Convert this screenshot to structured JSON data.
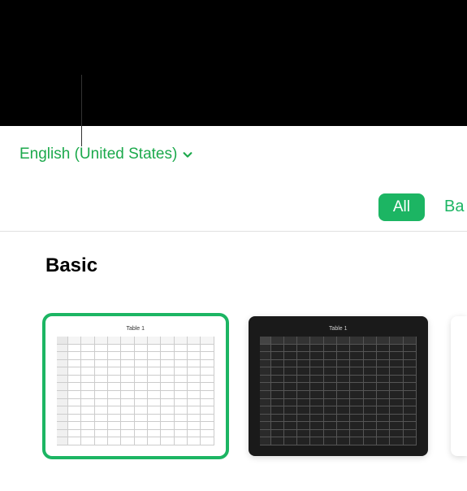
{
  "language": {
    "selected": "English (United States)"
  },
  "filters": {
    "all": "All",
    "basic_peek": "Ba"
  },
  "section": {
    "title": "Basic"
  },
  "templates": {
    "items": [
      {
        "title": "Table 1",
        "theme": "light",
        "selected": true
      },
      {
        "title": "Table 1",
        "theme": "dark",
        "selected": false
      }
    ]
  }
}
